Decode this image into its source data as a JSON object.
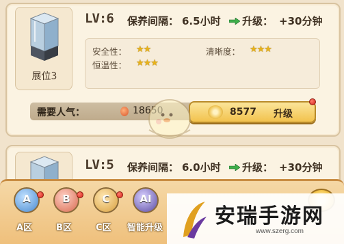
{
  "exhibits": [
    {
      "showcase_label": "展位3",
      "level": "LV:6",
      "interval_label": "保养间隔：",
      "interval_value": "6.5小时",
      "upgrade_label": "升级：",
      "upgrade_value": "+30分钟",
      "stats": [
        {
          "label": "安全性：",
          "stars": "★★"
        },
        {
          "label": "清晰度：",
          "stars": "★★★"
        },
        {
          "label": "恒温性：",
          "stars": "★★★"
        }
      ],
      "popularity_label": "需要人气：",
      "popularity_value": "18650",
      "button_cost": "8577",
      "button_label": "升级"
    },
    {
      "level": "LV:5",
      "interval_label": "保养间隔：",
      "interval_value": "6.0小时",
      "upgrade_label": "升级：",
      "upgrade_value": "+30分钟"
    }
  ],
  "zones": [
    {
      "icon_text": "A",
      "label": "A区",
      "color": "#5aa0e0"
    },
    {
      "icon_text": "B",
      "label": "B区",
      "color": "#e0705a"
    },
    {
      "icon_text": "C",
      "label": "C区",
      "color": "#e0a84a"
    },
    {
      "icon_text": "AI",
      "label": "智能升级",
      "color": "#6a5ab0"
    }
  ],
  "watermark": {
    "site_name": "安瑞手游网",
    "url": "www.szerg.com"
  },
  "icons": {
    "arrow": "arrow-right-icon",
    "flame": "popularity-icon",
    "coin": "flower-coin-icon"
  }
}
